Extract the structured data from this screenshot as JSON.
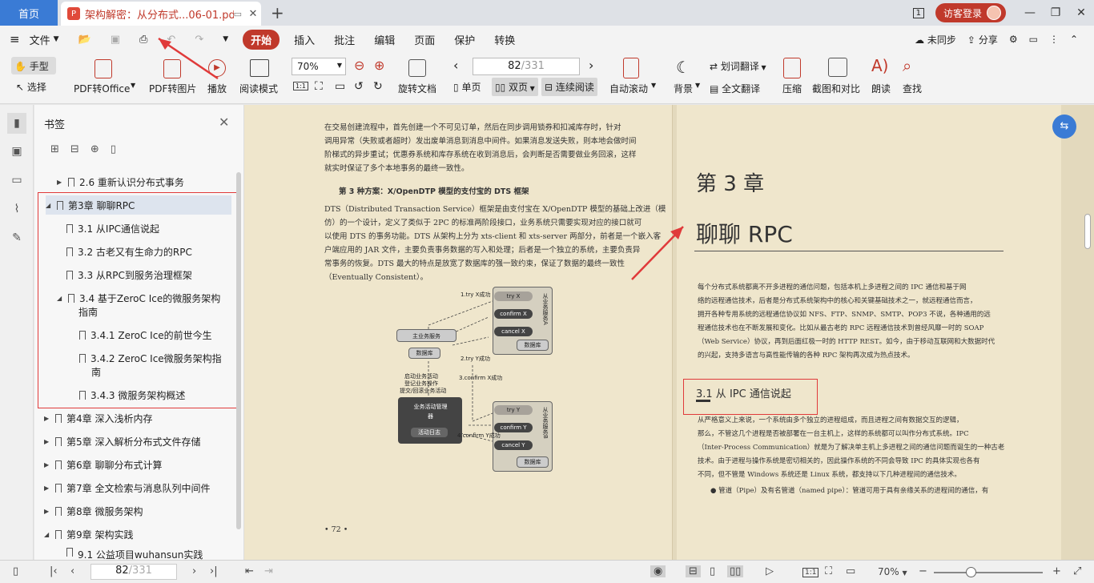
{
  "tabs": {
    "home": "首页",
    "doc_title": "架构解密：从分布式...06-01.pdf"
  },
  "titlebar": {
    "page_indicator": "1",
    "visitor": "访客登录"
  },
  "menu": {
    "file": "文件",
    "start": "开始",
    "insert": "插入",
    "annotate": "批注",
    "edit": "编辑",
    "page": "页面",
    "protect": "保护",
    "convert": "转换",
    "sync": "未同步",
    "share": "分享"
  },
  "toolbar": {
    "hand": "手型",
    "select": "选择",
    "pdf_office": "PDF转Office",
    "pdf_image": "PDF转图片",
    "play": "播放",
    "read_mode": "阅读模式",
    "zoom": "70%",
    "rotate": "旋转文档",
    "page_current": "82",
    "page_total": "/331",
    "single": "单页",
    "double": "双页",
    "continuous": "连续阅读",
    "auto_scroll": "自动滚动",
    "background": "背景",
    "word_translate": "划词翻译",
    "full_translate": "全文翻译",
    "compress": "压缩",
    "screenshot": "截图和对比",
    "read_aloud": "朗读",
    "find": "查找"
  },
  "sidebar": {
    "title": "书签",
    "items": [
      {
        "label": "2.6 重新认识分布式事务"
      },
      {
        "label": "第3章 聊聊RPC"
      },
      {
        "label": "3.1 从IPC通信说起"
      },
      {
        "label": "3.2 古老又有生命力的RPC"
      },
      {
        "label": "3.3 从RPC到服务治理框架"
      },
      {
        "label": "3.4 基于ZeroC Ice的微服务架构"
      },
      {
        "label": "指南"
      },
      {
        "label": "3.4.1 ZeroC Ice的前世今生"
      },
      {
        "label": "3.4.2 ZeroC Ice微服务架构指"
      },
      {
        "label": "南"
      },
      {
        "label": "3.4.3 微服务架构概述"
      },
      {
        "label": "第4章 深入浅析内存"
      },
      {
        "label": "第5章 深入解析分布式文件存储"
      },
      {
        "label": "第6章 聊聊分布式计算"
      },
      {
        "label": "第7章 全文检索与消息队列中间件"
      },
      {
        "label": "第8章 微服务架构"
      },
      {
        "label": "第9章 架构实践"
      },
      {
        "label": "9.1 公益项目wuhansun实践"
      }
    ]
  },
  "left_page": {
    "p1": [
      "在交易创建流程中，首先创建一个不可见订单，然后在同步调用锁券和扣减库存时，针对",
      "调用异常（失败或者超时）发出废单消息到消息中间件。如果消息发送失败，则本地会做时间",
      "阶梯式的异步重试；优惠券系统和库存系统在收到消息后，会判断是否需要做业务回滚，这样",
      "就实时保证了多个本地事务的最终一致性。"
    ],
    "h": "第 3 种方案：X/OpenDTP 模型的支付宝的 DTS 框架",
    "p2": [
      "DTS（Distributed Transaction Service）框架是由支付宝在 X/OpenDTP 模型的基础上改进（模",
      "仿）的一个设计，定义了类似于 2PC 的标准两阶段接口，业务系统只需要实现对应的接口就可",
      "以使用 DTS 的事务功能。DTS 从架构上分为 xts-client 和 xts-server 两部分，前者是一个嵌入客",
      "户端应用的 JAR 文件，主要负责事务数据的写入和处理；后者是一个独立的系统，主要负责异",
      "常事务的恢复。DTS 最大的特点是放宽了数据库的强一致约束，保证了数据的最终一致性",
      "（Eventually Consistent）。"
    ],
    "diagram": {
      "try_x": "1.try X成功",
      "tryx": "try X",
      "confirmx": "confirm X",
      "cancelx": "cancel X",
      "svc_a": "从业务服务A",
      "db": "数据库",
      "main_svc": "主业务服务",
      "main_db": "数据库",
      "try_y": "2.try Y成功",
      "confirm_x_ok": "3.confirm X成功",
      "start1": "启动业务活动",
      "start2": "登记业务操作",
      "start3": "提交/回滚业务活动",
      "manager": "业务活动管理器",
      "log": "活动日志",
      "tryy": "try Y",
      "confirmy": "confirm Y",
      "cancely": "cancel Y",
      "svc_b": "从业务服务B",
      "db2": "数据库",
      "confirm_y_ok": "4.confirm Y成功"
    },
    "page_no": "• 72 •"
  },
  "right_page": {
    "chapter": "第 3 章",
    "title": "聊聊 RPC",
    "p1": [
      "每个分布式系统都离不开多进程的通信问题，包括本机上多进程之间的 IPC 通信和基于网",
      "络的远程通信技术，后者是分布式系统架构中的核心和关键基础技术之一，就远程通信而言，",
      "拥开各种专用系统的远程通信协议如 NFS、FTP、SNMP、SMTP、POP3 不说，各种通用的远",
      "程通信技术也在不断发展和变化。比如从最古老的 RPC 远程通信技术到曾经风靡一时的 SOAP",
      "（Web Service）协议，再到后面红极一时的 HTTP REST。如今，由于移动互联网和大数据时代",
      "的兴起，支持多语言与高性能传输的各种 RPC 架构再次成为热点技术。"
    ],
    "section": "3.1   从 IPC 通信说起",
    "p2": [
      "从严格意义上来说，一个系统由多个独立的进程组成，而且进程之间有数据交互的逻辑，",
      "那么，不管这几个进程是否被部署在一台主机上，这样的系统都可以叫作分布式系统。IPC",
      "（Inter-Process Communication）就是为了解决单主机上多进程之间的通信问题而诞生的一种古老",
      "技术。由于进程与操作系统是密切相关的，因此操作系统的不同会导致 IPC 的具体实现也各有",
      "不同，但不管是 Windows 系统还是 Linux 系统，都支持以下几种进程间的通信技术。"
    ],
    "bullet": "管道（Pipe）及有名管道（named pipe）：管道可用于具有亲缘关系的进程间的通信，有"
  },
  "status": {
    "page_current": "82",
    "page_total": "/331",
    "zoom": "70%"
  }
}
